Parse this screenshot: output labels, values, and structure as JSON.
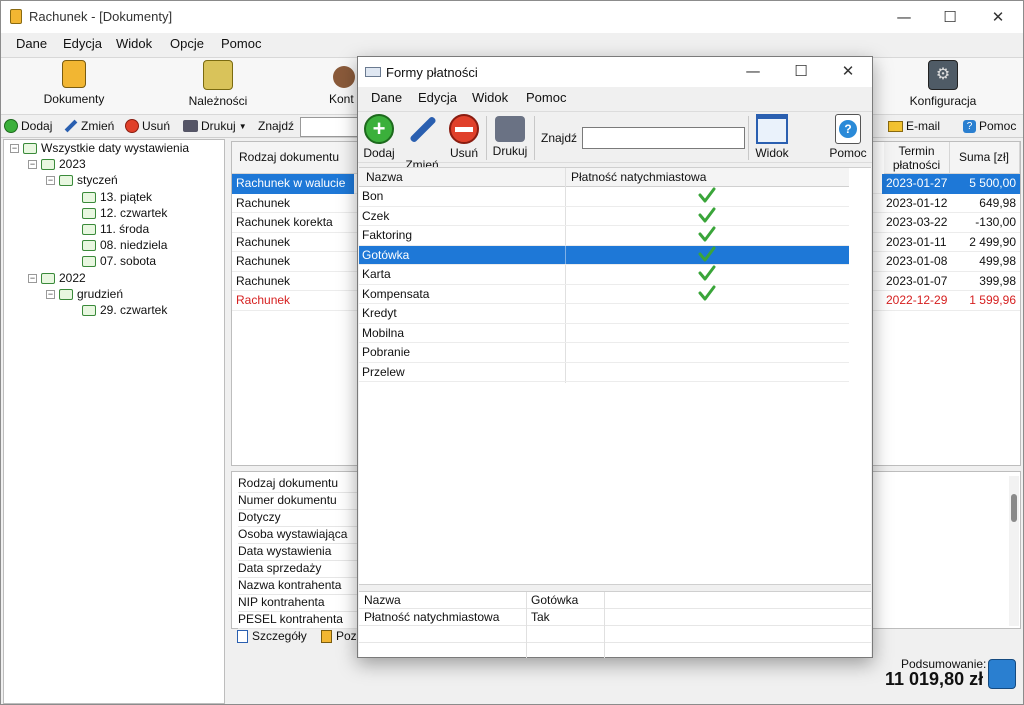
{
  "app": {
    "title": "Rachunek - [Dokumenty]",
    "menu": [
      "Dane",
      "Edycja",
      "Widok",
      "Opcje",
      "Pomoc"
    ],
    "ribbon": {
      "dokumenty": "Dokumenty",
      "naleznosci": "Należności",
      "kontrahenci_partial": "Kont",
      "konfiguracja": "Konfiguracja"
    },
    "toolbar": {
      "add": "Dodaj",
      "edit": "Zmień",
      "delete": "Usuń",
      "print": "Drukuj",
      "find_label": "Znajdź",
      "email": "E-mail",
      "help": "Pomoc"
    }
  },
  "tree": {
    "root": "Wszystkie daty wystawienia",
    "y2023": "2023",
    "styczen": "styczeń",
    "d13": "13. piątek",
    "d12": "12. czwartek",
    "d11": "11. środa",
    "d08": "08. niedziela",
    "d07": "07. sobota",
    "y2022": "2022",
    "grudzien": "grudzień",
    "d29": "29. czwartek"
  },
  "doclist": {
    "headers": {
      "type": "Rodzaj dokumentu",
      "due": "Termin\npłatności",
      "due_line1": "Termin",
      "due_line2": "płatności",
      "sum": "Suma [zł]"
    },
    "rows": [
      {
        "type": "Rachunek w walucie",
        "due": "2023-01-27",
        "sum": "5 500,00",
        "state": "selected"
      },
      {
        "type": "Rachunek",
        "due": "2023-01-12",
        "sum": "649,98",
        "state": "normal"
      },
      {
        "type": "Rachunek korekta",
        "due": "2023-03-22",
        "sum": "-130,00",
        "state": "normal"
      },
      {
        "type": "Rachunek",
        "due": "2023-01-11",
        "sum": "2 499,90",
        "state": "normal"
      },
      {
        "type": "Rachunek",
        "due": "2023-01-08",
        "sum": "499,98",
        "state": "normal"
      },
      {
        "type": "Rachunek",
        "due": "2023-01-07",
        "sum": "399,98",
        "state": "normal"
      },
      {
        "type": "Rachunek",
        "due": "2022-12-29",
        "sum": "1 599,96",
        "state": "overdue"
      }
    ]
  },
  "details": {
    "labels": [
      "Rodzaj dokumentu",
      "Numer dokumentu",
      "Dotyczy",
      "Osoba wystawiająca",
      "Data wystawienia",
      "Data sprzedaży",
      "Nazwa kontrahenta",
      "NIP kontrahenta",
      "PESEL kontrahenta"
    ],
    "tab_details": "Szczegóły",
    "tab_second_partial": "Poz"
  },
  "summary": {
    "label": "Podsumowanie:",
    "value": "11 019,80 zł"
  },
  "dialog": {
    "title": "Formy płatności",
    "menu": [
      "Dane",
      "Edycja",
      "Widok",
      "Pomoc"
    ],
    "toolbar": {
      "add": "Dodaj",
      "edit": "Zmień",
      "delete": "Usuń",
      "print": "Drukuj",
      "find_label": "Znajdź",
      "find_value": "",
      "view": "Widok",
      "help": "Pomoc"
    },
    "grid": {
      "col_name": "Nazwa",
      "col_instant": "Płatność natychmiastowa",
      "rows": [
        {
          "name": "Bon",
          "instant": true
        },
        {
          "name": "Czek",
          "instant": true
        },
        {
          "name": "Faktoring",
          "instant": true
        },
        {
          "name": "Gotówka",
          "instant": true
        },
        {
          "name": "Karta",
          "instant": true
        },
        {
          "name": "Kompensata",
          "instant": true
        },
        {
          "name": "Kredyt",
          "instant": false
        },
        {
          "name": "Mobilna",
          "instant": false
        },
        {
          "name": "Pobranie",
          "instant": false
        },
        {
          "name": "Przelew",
          "instant": false
        }
      ],
      "selected": "Gotówka"
    },
    "detail": {
      "name_label": "Nazwa",
      "name_value": "Gotówka",
      "instant_label": "Płatność natychmiastowa",
      "instant_value": "Tak"
    }
  },
  "colors": {
    "selection": "#1e78d7",
    "overdue": "#d62020",
    "check": "#3aa53a"
  }
}
